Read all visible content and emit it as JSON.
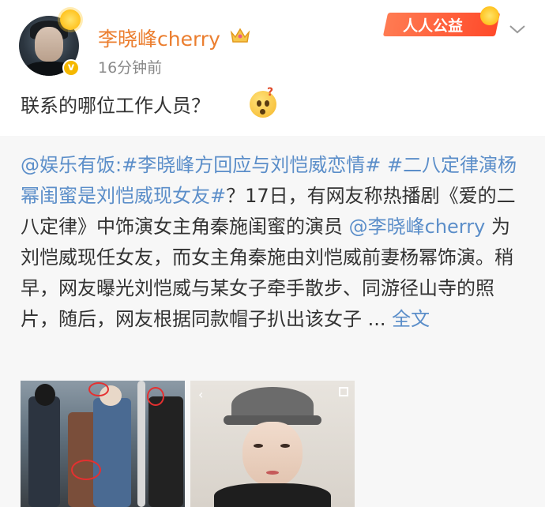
{
  "post": {
    "username": "李晓峰cherry",
    "timestamp": "16分钟前",
    "text": "联系的哪位工作人员？",
    "badge_text": "人人公益",
    "verified_icon": "v"
  },
  "repost": {
    "mention_source": "@娱乐有饭",
    "colon": ":",
    "hashtag1": "#李晓峰方回应与刘恺威恋情#",
    "hashtag2": "#二八定律演杨幂闺蜜是刘恺威现女友#",
    "text1": "？17日，有网友称热播剧《爱的二八定律》中饰演女主角秦施闺蜜的演员",
    "mention_user": "@李晓峰cherry",
    "text2": "为刘恺威现任女友，而女主角秦施由刘恺威前妻杨幂饰演。稍早，网友曝光刘恺威与某女子牵手散步、同游径山寺的照片，随后，网友根据同款帽子扒出该女子 ...",
    "full_text_link": "全文"
  },
  "icons": {
    "chevron": "chevron-down-icon",
    "crown": "crown-icon",
    "emoji": "thinking-emoji-icon"
  }
}
